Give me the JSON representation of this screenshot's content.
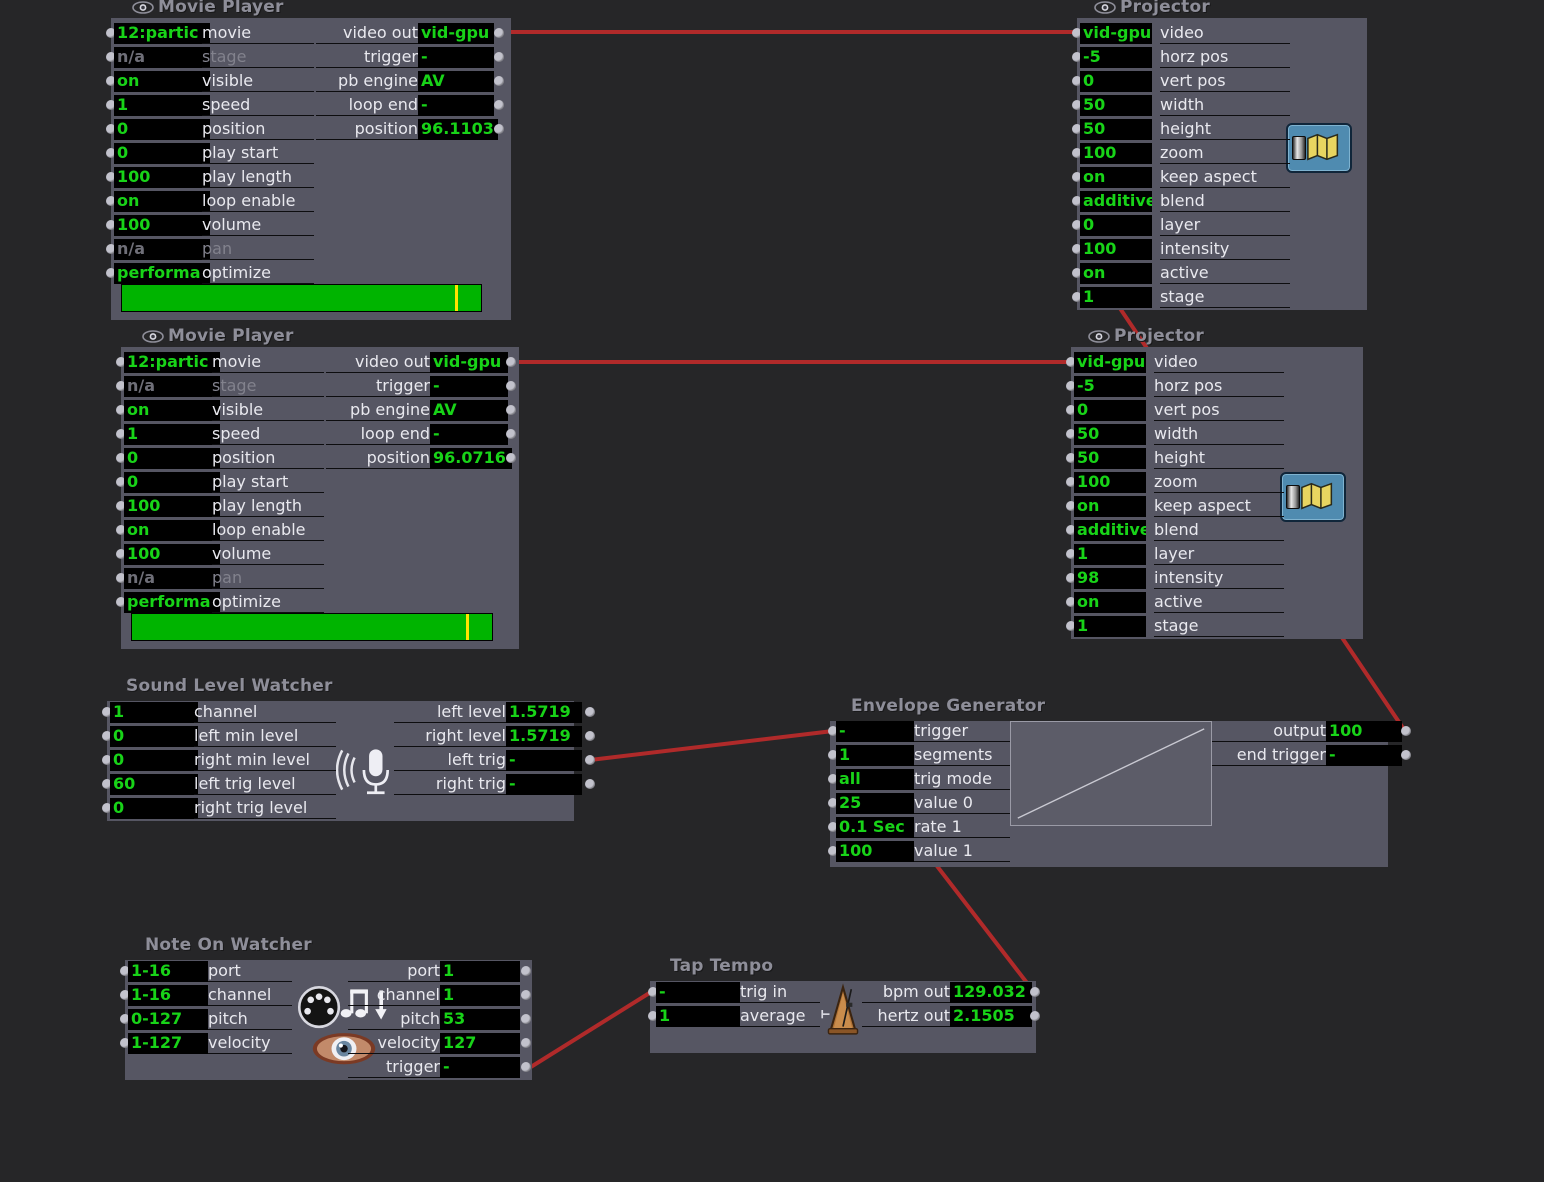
{
  "app": {
    "canvas_bg": "#262628",
    "node_bg": "#565663",
    "value_text_color": "#18d318",
    "wire_color": "#b02a2a"
  },
  "nodes": [
    {
      "id": "movie-player-1",
      "title": "Movie Player",
      "icon": "eye-icon",
      "inputs": [
        {
          "value": "12:partic",
          "label": "movie"
        },
        {
          "value": "n/a",
          "label": "stage",
          "dim": true
        },
        {
          "value": "on",
          "label": "visible"
        },
        {
          "value": "1",
          "label": "speed"
        },
        {
          "value": "0",
          "label": "position"
        },
        {
          "value": "0",
          "label": "play start"
        },
        {
          "value": "100",
          "label": "play length"
        },
        {
          "value": "on",
          "label": "loop enable"
        },
        {
          "value": "100",
          "label": "volume"
        },
        {
          "value": "n/a",
          "label": "pan",
          "dim": true
        },
        {
          "value": "performa",
          "label": "optimize"
        }
      ],
      "outputs": [
        {
          "label": "video out",
          "value": "vid-gpu"
        },
        {
          "label": "trigger",
          "value": "-"
        },
        {
          "label": "pb engine",
          "value": "AV"
        },
        {
          "label": "loop end",
          "value": "-"
        },
        {
          "label": "position",
          "value": "96.1103"
        }
      ],
      "progress_percent": 96
    },
    {
      "id": "projector-1",
      "title": "Projector",
      "icon": "eye-icon",
      "inputs": [
        {
          "value": "vid-gpu",
          "label": "video"
        },
        {
          "value": "-5",
          "label": "horz pos"
        },
        {
          "value": "0",
          "label": "vert pos"
        },
        {
          "value": "50",
          "label": "width"
        },
        {
          "value": "50",
          "label": "height"
        },
        {
          "value": "100",
          "label": "zoom"
        },
        {
          "value": "on",
          "label": "keep aspect"
        },
        {
          "value": "additive",
          "label": "blend"
        },
        {
          "value": "0",
          "label": "layer"
        },
        {
          "value": "100",
          "label": "intensity"
        },
        {
          "value": "on",
          "label": "active"
        },
        {
          "value": "1",
          "label": "stage"
        }
      ],
      "badge_icon": "projector-map-icon"
    },
    {
      "id": "movie-player-2",
      "title": "Movie Player",
      "icon": "eye-icon",
      "inputs": [
        {
          "value": "12:partic",
          "label": "movie"
        },
        {
          "value": "n/a",
          "label": "stage",
          "dim": true
        },
        {
          "value": "on",
          "label": "visible"
        },
        {
          "value": "1",
          "label": "speed"
        },
        {
          "value": "0",
          "label": "position"
        },
        {
          "value": "0",
          "label": "play start"
        },
        {
          "value": "100",
          "label": "play length"
        },
        {
          "value": "on",
          "label": "loop enable"
        },
        {
          "value": "100",
          "label": "volume"
        },
        {
          "value": "n/a",
          "label": "pan",
          "dim": true
        },
        {
          "value": "performa",
          "label": "optimize"
        }
      ],
      "outputs": [
        {
          "label": "video out",
          "value": "vid-gpu"
        },
        {
          "label": "trigger",
          "value": "-"
        },
        {
          "label": "pb engine",
          "value": "AV"
        },
        {
          "label": "loop end",
          "value": "-"
        },
        {
          "label": "position",
          "value": "96.0716"
        }
      ],
      "progress_percent": 96
    },
    {
      "id": "projector-2",
      "title": "Projector",
      "icon": "eye-icon",
      "inputs": [
        {
          "value": "vid-gpu",
          "label": "video"
        },
        {
          "value": "-5",
          "label": "horz pos"
        },
        {
          "value": "0",
          "label": "vert pos"
        },
        {
          "value": "50",
          "label": "width"
        },
        {
          "value": "50",
          "label": "height"
        },
        {
          "value": "100",
          "label": "zoom"
        },
        {
          "value": "on",
          "label": "keep aspect"
        },
        {
          "value": "additive",
          "label": "blend"
        },
        {
          "value": "1",
          "label": "layer"
        },
        {
          "value": "98",
          "label": "intensity"
        },
        {
          "value": "on",
          "label": "active"
        },
        {
          "value": "1",
          "label": "stage"
        }
      ],
      "badge_icon": "projector-map-icon"
    },
    {
      "id": "sound-level-watcher",
      "title": "Sound Level Watcher",
      "inputs": [
        {
          "value": "1",
          "label": "channel"
        },
        {
          "value": "0",
          "label": "left min level"
        },
        {
          "value": "0",
          "label": "right min level"
        },
        {
          "value": "60",
          "label": "left trig level"
        },
        {
          "value": "0",
          "label": "right trig level"
        }
      ],
      "outputs": [
        {
          "label": "left level",
          "value": "1.5719"
        },
        {
          "label": "right level",
          "value": "1.5719"
        },
        {
          "label": "left trig",
          "value": "-"
        },
        {
          "label": "right trig",
          "value": "-"
        }
      ],
      "badge_icon": "microphone-icon"
    },
    {
      "id": "envelope-generator",
      "title": "Envelope Generator",
      "inputs": [
        {
          "value": "-",
          "label": "trigger"
        },
        {
          "value": "1",
          "label": "segments"
        },
        {
          "value": "all",
          "label": "trig mode"
        },
        {
          "value": "25",
          "label": "value 0"
        },
        {
          "value": "0.1 Sec",
          "label": "rate 1"
        },
        {
          "value": "100",
          "label": "value 1"
        }
      ],
      "outputs": [
        {
          "label": "output",
          "value": "100"
        },
        {
          "label": "end trigger",
          "value": "-"
        }
      ],
      "badge_icon": "ramp-graph"
    },
    {
      "id": "note-on-watcher",
      "title": "Note On Watcher",
      "inputs": [
        {
          "value": "1-16",
          "label": "port"
        },
        {
          "value": "1-16",
          "label": "channel"
        },
        {
          "value": "0-127",
          "label": "pitch"
        },
        {
          "value": "1-127",
          "label": "velocity"
        }
      ],
      "outputs": [
        {
          "label": "port",
          "value": "1"
        },
        {
          "label": "channel",
          "value": "1"
        },
        {
          "label": "pitch",
          "value": "53"
        },
        {
          "label": "velocity",
          "value": "127"
        },
        {
          "label": "trigger",
          "value": "-"
        }
      ],
      "badge_icon": "midi-note-eye-icon"
    },
    {
      "id": "tap-tempo",
      "title": "Tap Tempo",
      "inputs": [
        {
          "value": "-",
          "label": "trig in"
        },
        {
          "value": "1",
          "label": "average"
        }
      ],
      "outputs": [
        {
          "label": "bpm out",
          "value": "129.032"
        },
        {
          "label": "hertz out",
          "value": "2.1505"
        }
      ],
      "badge_icon": "metronome-icon"
    }
  ],
  "connections": [
    {
      "from": "movie-player-1.video out",
      "to": "projector-1.video"
    },
    {
      "from": "movie-player-2.video out",
      "to": "projector-2.video"
    },
    {
      "from": "envelope-generator.output",
      "to": "projector-1.intensity"
    },
    {
      "from": "sound-level-watcher.left trig",
      "to": "envelope-generator.trigger"
    },
    {
      "from": "tap-tempo.bpm out",
      "to": "envelope-generator.trigger"
    },
    {
      "from": "note-on-watcher.trigger",
      "to": "tap-tempo.trig in"
    }
  ]
}
